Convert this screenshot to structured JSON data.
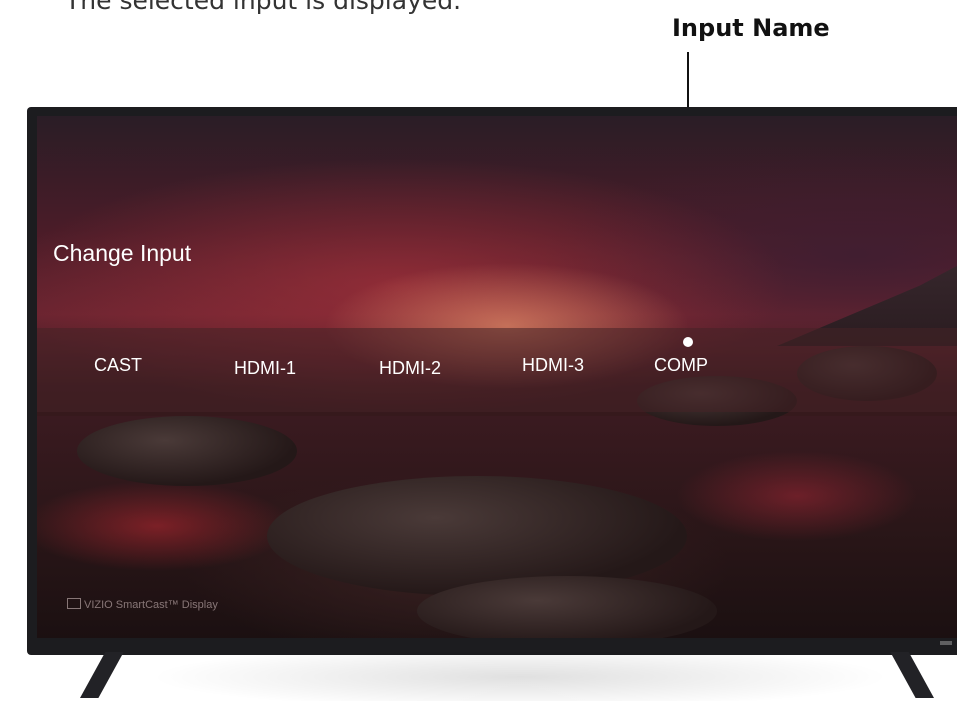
{
  "caption": "The selected input is displayed.",
  "callout": {
    "label": "Input Name"
  },
  "tv": {
    "menu_title": "Change Input",
    "inputs": [
      "CAST",
      "HDMI-1",
      "HDMI-2",
      "HDMI-3",
      "COMP"
    ],
    "selected_input": "COMP",
    "brand_text": "VIZIO SmartCast™ Display"
  },
  "colors": {
    "menu_text": "#ffffff",
    "callout_line": "#111111",
    "tv_bezel": "#1c1c1f"
  }
}
